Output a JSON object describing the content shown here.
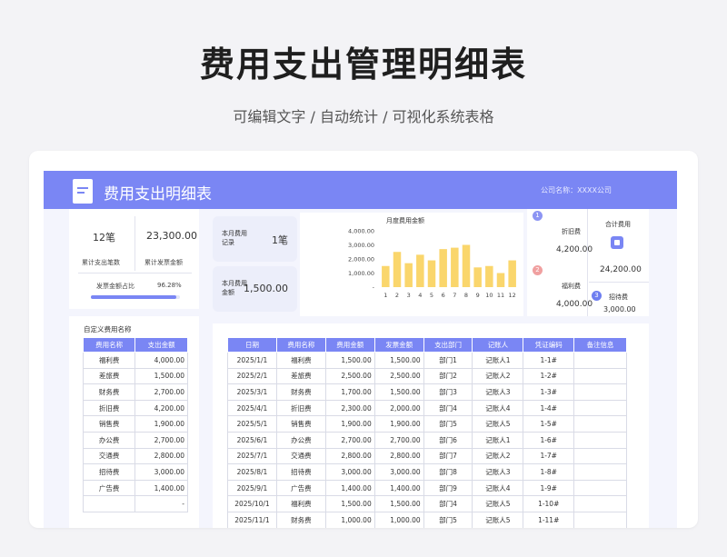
{
  "hero": {
    "title": "费用支出管理明细表",
    "subtitle": "可编辑文字 / 自动统计 / 可视化系统表格"
  },
  "banner": {
    "title": "费用支出明细表",
    "company": "公司名称：XXXX公司",
    "icon": "receipt-icon"
  },
  "summary": {
    "count_value": "12笔",
    "count_label": "累计支出笔数",
    "invoice_value": "23,300.00",
    "invoice_label": "累计发票金额",
    "ratio_label": "发票金额占比",
    "ratio_value": "96.28%",
    "ratio_fraction": 0.9628
  },
  "monthly": {
    "records_label": "本月费用记录",
    "records_value": "1笔",
    "amount_label": "本月费用金额",
    "amount_value": "1,500.00"
  },
  "chart_data": {
    "type": "bar",
    "title": "月度费用金额",
    "categories": [
      "1",
      "2",
      "3",
      "4",
      "5",
      "6",
      "7",
      "8",
      "9",
      "10",
      "11",
      "12"
    ],
    "values": [
      1500,
      2500,
      1700,
      2300,
      1900,
      2700,
      2800,
      3000,
      1400,
      1500,
      1000,
      1900
    ],
    "y_ticks": [
      "4,000.00",
      "3,000.00",
      "2,000.00",
      "1,000.00",
      "-"
    ],
    "ylim": [
      0,
      4000
    ],
    "color": "#fad66c"
  },
  "top3": {
    "items": [
      {
        "rank": "1",
        "name": "折旧费",
        "value": "4,200.00",
        "color": "#8d95f3"
      },
      {
        "rank": "2",
        "name": "福利费",
        "value": "4,000.00",
        "color": "#f0a0a0"
      },
      {
        "rank": "3",
        "name": "招待费",
        "value": "3,000.00",
        "color": "#6e7ef0"
      }
    ],
    "total_label": "合计费用",
    "total_value": "24,200.00"
  },
  "custom": {
    "caption": "自定义费用名称",
    "headers": [
      "费用名称",
      "支出金额"
    ],
    "rows": [
      [
        "福利费",
        "4,000.00"
      ],
      [
        "差旅费",
        "1,500.00"
      ],
      [
        "财务费",
        "2,700.00"
      ],
      [
        "折旧费",
        "4,200.00"
      ],
      [
        "销售费",
        "1,900.00"
      ],
      [
        "办公费",
        "2,700.00"
      ],
      [
        "交通费",
        "2,800.00"
      ],
      [
        "招待费",
        "3,000.00"
      ],
      [
        "广告费",
        "1,400.00"
      ],
      [
        "",
        "-"
      ]
    ]
  },
  "detail": {
    "headers": [
      "日期",
      "费用名称",
      "费用金额",
      "发票金额",
      "支出部门",
      "记账人",
      "凭证编码",
      "备注信息"
    ],
    "rows": [
      [
        "2025/1/1",
        "福利费",
        "1,500.00",
        "1,500.00",
        "部门1",
        "记账人1",
        "1-1#",
        ""
      ],
      [
        "2025/2/1",
        "差旅费",
        "2,500.00",
        "2,500.00",
        "部门2",
        "记账人2",
        "1-2#",
        ""
      ],
      [
        "2025/3/1",
        "财务费",
        "1,700.00",
        "1,500.00",
        "部门3",
        "记账人3",
        "1-3#",
        ""
      ],
      [
        "2025/4/1",
        "折旧费",
        "2,300.00",
        "2,000.00",
        "部门4",
        "记账人4",
        "1-4#",
        ""
      ],
      [
        "2025/5/1",
        "销售费",
        "1,900.00",
        "1,900.00",
        "部门5",
        "记账人5",
        "1-5#",
        ""
      ],
      [
        "2025/6/1",
        "办公费",
        "2,700.00",
        "2,700.00",
        "部门6",
        "记账人1",
        "1-6#",
        ""
      ],
      [
        "2025/7/1",
        "交通费",
        "2,800.00",
        "2,800.00",
        "部门7",
        "记账人2",
        "1-7#",
        ""
      ],
      [
        "2025/8/1",
        "招待费",
        "3,000.00",
        "3,000.00",
        "部门8",
        "记账人3",
        "1-8#",
        ""
      ],
      [
        "2025/9/1",
        "广告费",
        "1,400.00",
        "1,400.00",
        "部门9",
        "记账人4",
        "1-9#",
        ""
      ],
      [
        "2025/10/1",
        "福利费",
        "1,500.00",
        "1,500.00",
        "部门4",
        "记账人5",
        "1-10#",
        ""
      ],
      [
        "2025/11/1",
        "财务费",
        "1,000.00",
        "1,000.00",
        "部门5",
        "记账人5",
        "1-11#",
        ""
      ]
    ]
  }
}
